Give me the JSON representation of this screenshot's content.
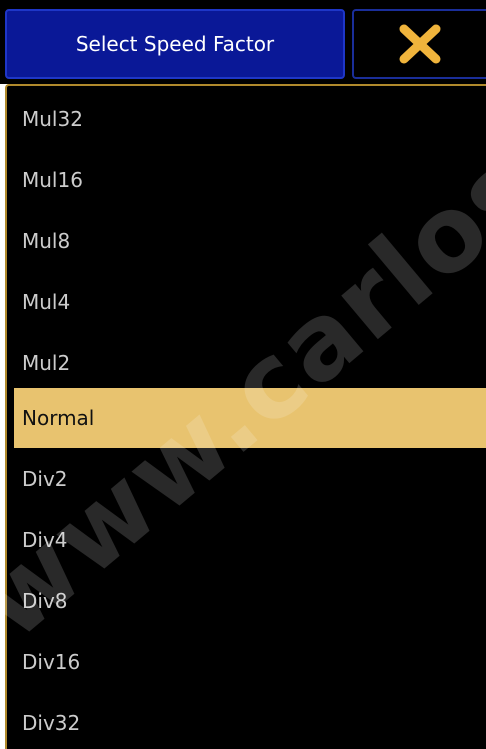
{
  "dialog": {
    "title": "Select Speed Factor",
    "close_icon": "close-x-icon",
    "close_color": "#f0b43c"
  },
  "list": {
    "selected": "Normal",
    "items": [
      {
        "label": "Mul32"
      },
      {
        "label": "Mul16"
      },
      {
        "label": "Mul8"
      },
      {
        "label": "Mul4"
      },
      {
        "label": "Mul2"
      },
      {
        "label": "Normal"
      },
      {
        "label": "Div2"
      },
      {
        "label": "Div4"
      },
      {
        "label": "Div8"
      },
      {
        "label": "Div16"
      },
      {
        "label": "Div32"
      }
    ]
  },
  "watermark": {
    "text": "www.carlosm"
  },
  "colors": {
    "title_bg": "#0a1897",
    "title_border": "#1e36c8",
    "selected_bg": "#e8c36f",
    "panel_border": "#b08a2c"
  }
}
